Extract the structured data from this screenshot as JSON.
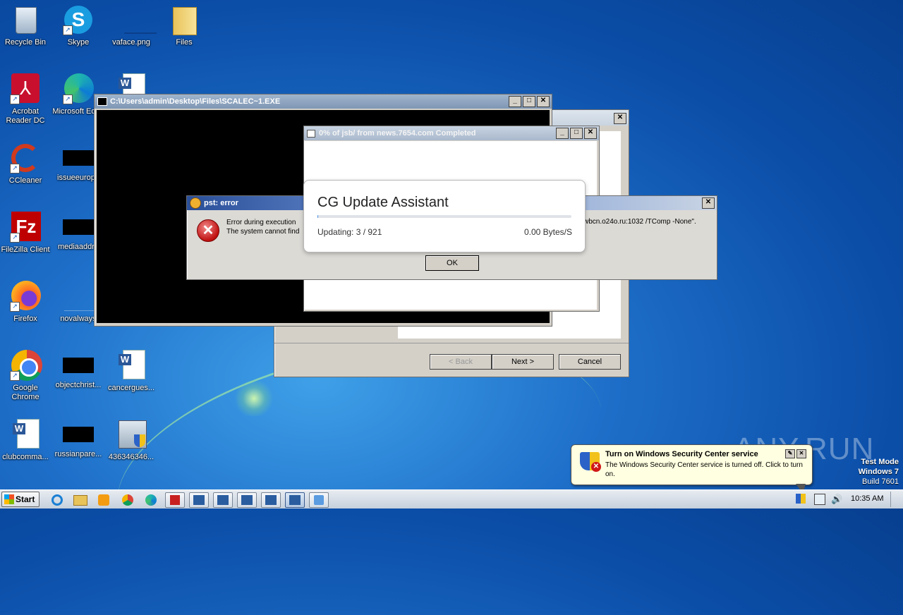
{
  "desktop": {
    "icons": [
      {
        "label": "Recycle Bin"
      },
      {
        "label": "Skype"
      },
      {
        "label": "vaface.png"
      },
      {
        "label": "Files"
      },
      {
        "label": "Acrobat Reader DC"
      },
      {
        "label": "Microsoft Edge"
      },
      {
        "label": "CCleaner"
      },
      {
        "label": "issueeurope"
      },
      {
        "label": "FileZilla Client"
      },
      {
        "label": "mediaaddre"
      },
      {
        "label": "Firefox"
      },
      {
        "label": "novalways"
      },
      {
        "label": "Google Chrome"
      },
      {
        "label": "objectchrist..."
      },
      {
        "label": "cancergues..."
      },
      {
        "label": "clubcomma..."
      },
      {
        "label": "russianpare..."
      },
      {
        "label": "436346346..."
      }
    ]
  },
  "console_window": {
    "title": "C:\\Users\\admin\\Desktop\\Files\\SCALEC~1.EXE"
  },
  "installer_window": {
    "back_label": "< Back",
    "next_label": "Next >",
    "cancel_label": "Cancel"
  },
  "download_window": {
    "title": "0% of jsb/ from news.7654.com Completed"
  },
  "error_dialog": {
    "title": "pst: error",
    "line1_left": "Error during execution",
    "line1_right": "wbcn.o24o.ru:1032 /TComp -None\".",
    "line2_left": "The system cannot find",
    "ok_label": "OK"
  },
  "update_assistant": {
    "title": "CG Update Assistant",
    "status": "Updating: 3 / 921",
    "speed": "0.00 Bytes/S",
    "progress": 0.003
  },
  "notification": {
    "title": "Turn on Windows Security Center service",
    "body": "The Windows Security Center service is turned off. Click to turn on."
  },
  "watermark": {
    "text": "ANY.RUN",
    "test_mode": "Test Mode",
    "os": "Windows 7",
    "build": "Build 7601"
  },
  "taskbar": {
    "start_label": "Start",
    "clock": "10:35 AM"
  }
}
